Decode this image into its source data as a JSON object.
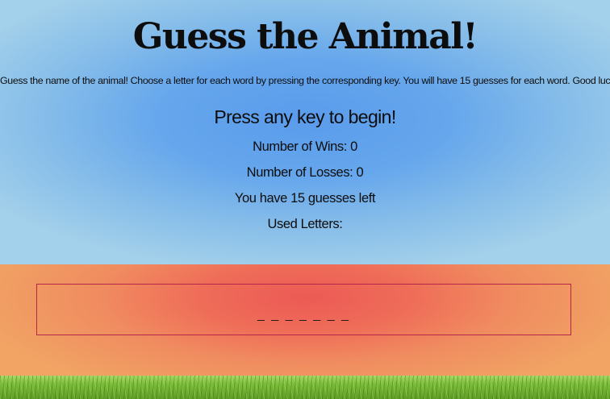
{
  "header": {
    "title": "Guess the Animal!",
    "instructions": "Guess the name of the animal! Choose a letter for each word by pressing the corresponding key. You will have 15 guesses for each word. Good luck!"
  },
  "game": {
    "prompt": "Press any key to begin!",
    "wins_text": "Number of Wins: 0",
    "losses_text": "Number of Losses: 0",
    "guesses_text": "You have 15 guesses left",
    "used_letters_text": "Used Letters:",
    "word_display": "_ _ _ _ _ _ _"
  },
  "colors": {
    "sky_center": "#5a9cec",
    "sky_edge": "#a3d0ea",
    "band_center": "#ec5a55",
    "band_edge": "#f1a464",
    "box_border": "#b3264a",
    "grass": "#7cbe3a"
  }
}
